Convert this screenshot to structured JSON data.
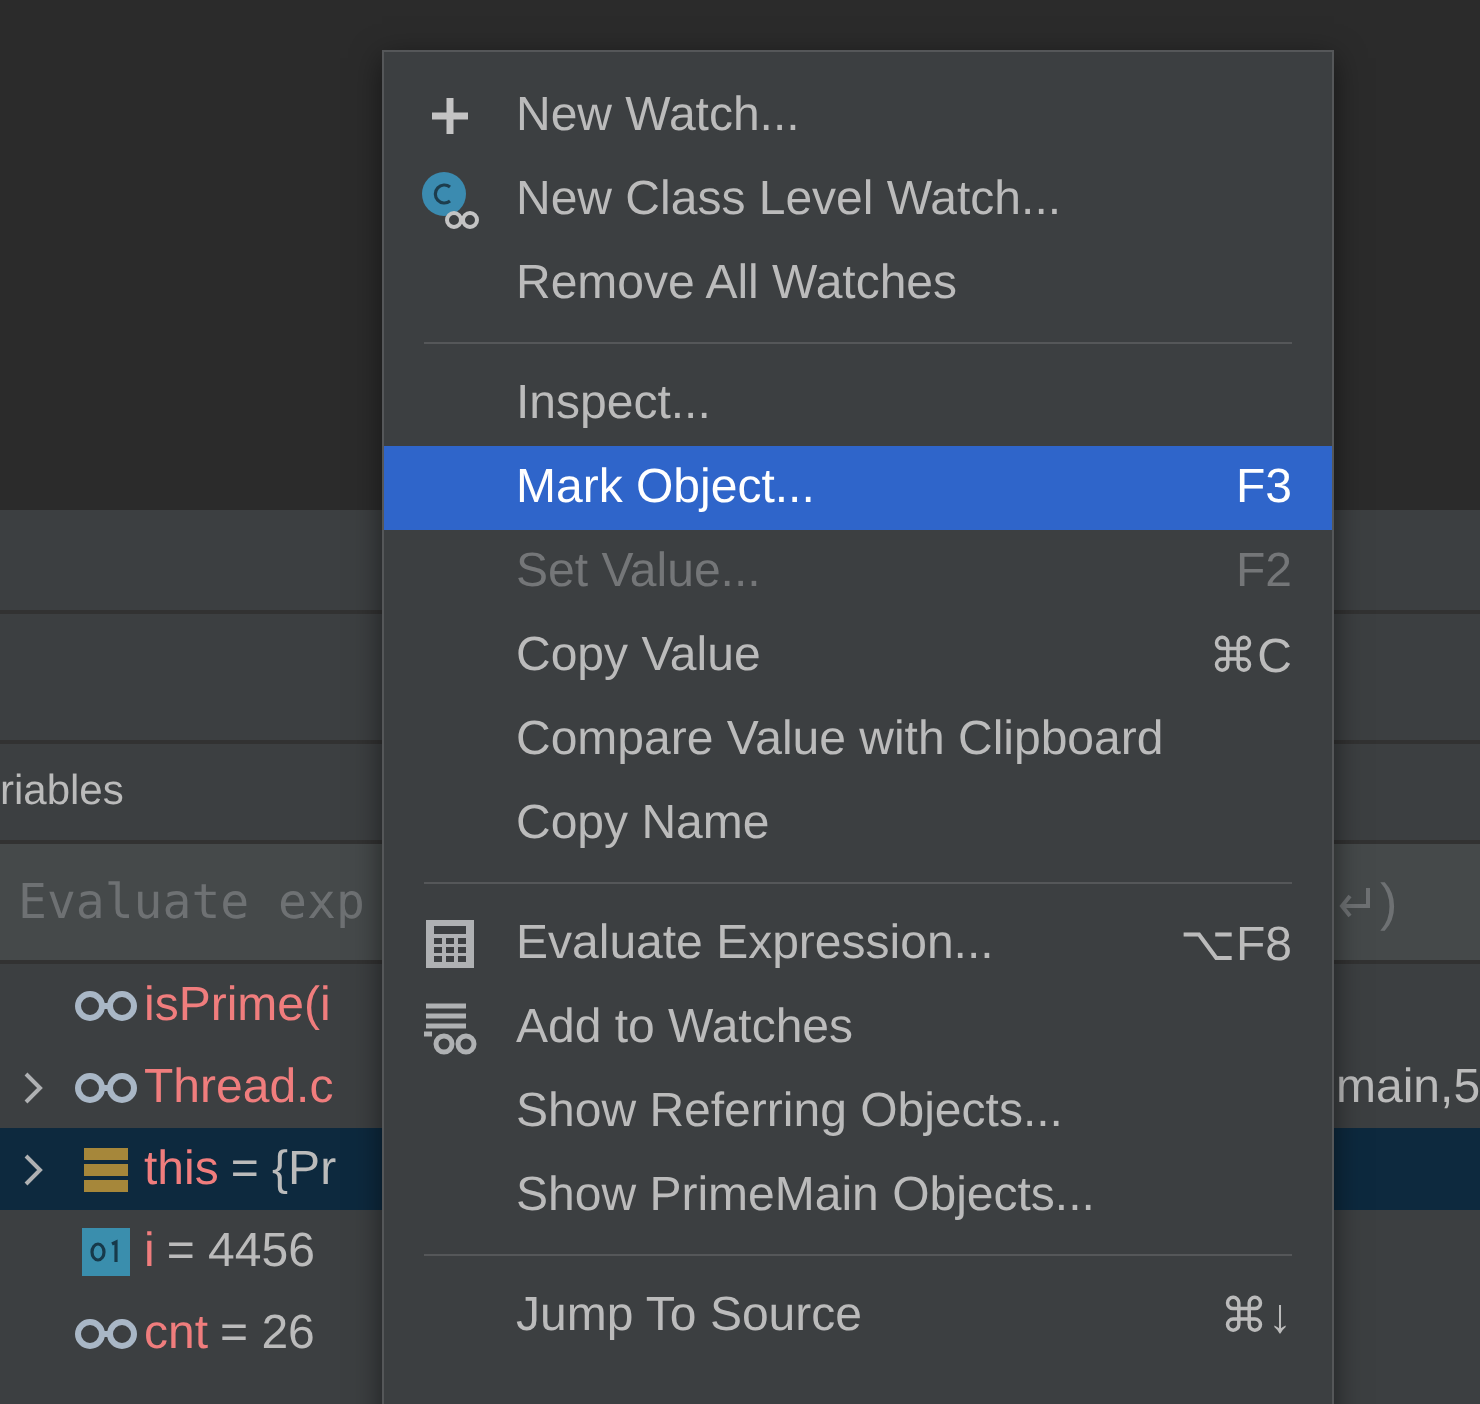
{
  "variables_panel": {
    "header": "riables",
    "evaluate_field": {
      "placeholder": "Evaluate exp",
      "hint_end": ")"
    },
    "rows": [
      {
        "kind": "watch",
        "name": "isPrime(i",
        "expandable": false,
        "selected": false
      },
      {
        "kind": "watch",
        "name": "Thread.c",
        "expandable": true,
        "selected": false,
        "right": "main,5"
      },
      {
        "kind": "object",
        "name": "this",
        "value": "= {Pr",
        "expandable": true,
        "selected": true
      },
      {
        "kind": "primitive",
        "name": "i",
        "value": "= 4456",
        "expandable": false,
        "selected": false
      },
      {
        "kind": "watch",
        "name": "cnt",
        "value": "= 26",
        "expandable": false,
        "selected": false
      }
    ]
  },
  "context_menu": {
    "items": [
      {
        "kind": "add",
        "label": "New Watch...",
        "disabled": false,
        "selected": false
      },
      {
        "kind": "class-watch",
        "label": "New Class Level Watch...",
        "disabled": false,
        "selected": false
      },
      {
        "kind": "plain",
        "label": "Remove All Watches",
        "disabled": false,
        "selected": false
      },
      {
        "kind": "separator"
      },
      {
        "kind": "plain",
        "label": "Inspect...",
        "disabled": false,
        "selected": false
      },
      {
        "kind": "plain",
        "label": "Mark Object...",
        "shortcut": "F3",
        "disabled": false,
        "selected": true
      },
      {
        "kind": "plain",
        "label": "Set Value...",
        "shortcut": "F2",
        "disabled": true,
        "selected": false
      },
      {
        "kind": "plain",
        "label": "Copy Value",
        "shortcut": "⌘C",
        "disabled": false,
        "selected": false
      },
      {
        "kind": "plain",
        "label": "Compare Value with Clipboard",
        "disabled": false,
        "selected": false
      },
      {
        "kind": "plain",
        "label": "Copy Name",
        "disabled": false,
        "selected": false
      },
      {
        "kind": "separator"
      },
      {
        "kind": "evaluate",
        "label": "Evaluate Expression...",
        "shortcut": "⌥F8",
        "disabled": false,
        "selected": false
      },
      {
        "kind": "add-watch",
        "label": "Add to Watches",
        "disabled": false,
        "selected": false
      },
      {
        "kind": "plain",
        "label": "Show Referring Objects...",
        "disabled": false,
        "selected": false
      },
      {
        "kind": "plain",
        "label": "Show PrimeMain Objects...",
        "disabled": false,
        "selected": false
      },
      {
        "kind": "separator"
      },
      {
        "kind": "plain",
        "label": "Jump To Source",
        "shortcut": "⌘↓",
        "disabled": false,
        "selected": false
      }
    ]
  }
}
